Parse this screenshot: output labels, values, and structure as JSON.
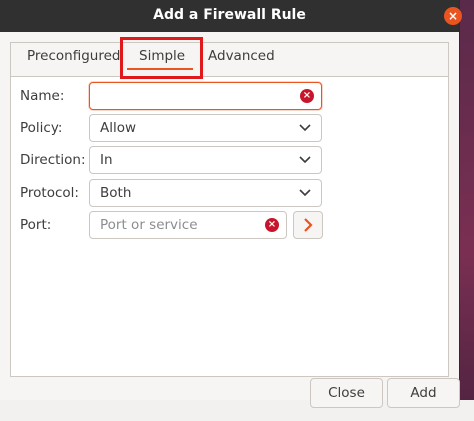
{
  "window": {
    "title": "Add a Firewall Rule",
    "close_glyph": "×"
  },
  "tabs": [
    {
      "label": "Preconfigured"
    },
    {
      "label": "Simple"
    },
    {
      "label": "Advanced"
    }
  ],
  "form": {
    "name": {
      "label": "Name:",
      "value": ""
    },
    "policy": {
      "label": "Policy:",
      "value": "Allow"
    },
    "direction": {
      "label": "Direction:",
      "value": "In"
    },
    "protocol": {
      "label": "Protocol:",
      "value": "Both"
    },
    "port": {
      "label": "Port:",
      "placeholder": "Port or service"
    }
  },
  "buttons": {
    "close": "Close",
    "add": "Add"
  },
  "icons": {
    "clear": "clear-icon",
    "dropdown": "chevron-down-icon",
    "go": "chevron-right-icon",
    "window_close": "close-icon"
  },
  "colors": {
    "accent": "#e95420",
    "clear": "#c7162b",
    "highlight": "#e0191b",
    "titlebar": "#303030"
  }
}
